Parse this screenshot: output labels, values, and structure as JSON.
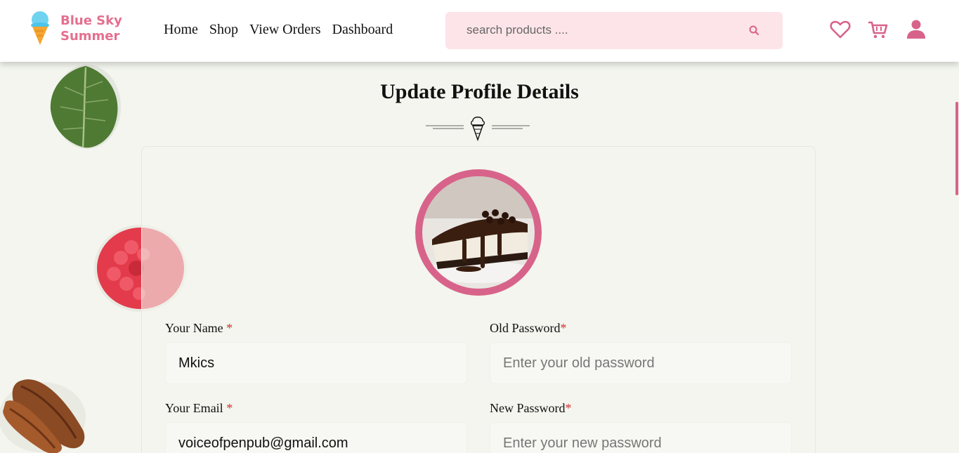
{
  "brand": {
    "line1": "Blue Sky",
    "line2": "Summer"
  },
  "nav": [
    "Home",
    "Shop",
    "View Orders",
    "Dashboard"
  ],
  "search": {
    "placeholder": "search products ...."
  },
  "page": {
    "title": "Update Profile Details"
  },
  "form": {
    "name_label": "Your Name ",
    "name_value": "Mkics",
    "email_label": "Your Email ",
    "email_value": "voiceofpenpub@gmail.com",
    "old_password_label": "Old Password",
    "old_password_placeholder": "Enter your old password",
    "new_password_label": "New Password",
    "new_password_placeholder": "Enter your new password",
    "required_mark": "*"
  },
  "colors": {
    "accent": "#d8638a",
    "search_bg": "#fde4e9",
    "page_bg": "#f3f5ee"
  },
  "icons": [
    "ice-cream-logo-icon",
    "search-icon",
    "heart-icon",
    "cart-icon",
    "user-icon"
  ]
}
